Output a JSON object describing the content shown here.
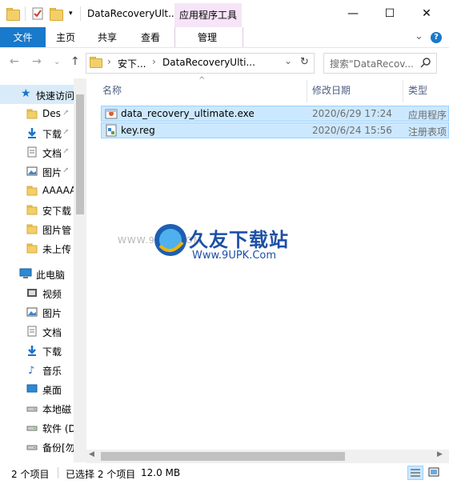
{
  "window": {
    "title": "DataRecoveryUlt...",
    "context_tab_header": "应用程序工具",
    "minimize": "—",
    "maximize": "☐",
    "close": "✕"
  },
  "ribbon": {
    "file": "文件",
    "home": "主页",
    "share": "共享",
    "view": "查看",
    "manage": "管理",
    "expand": "⌄",
    "help": "?"
  },
  "address": {
    "crumb1": "安下...",
    "crumb2": "DataRecoveryUlti...",
    "sep": "›",
    "search_placeholder": "搜索\"DataRecov...",
    "refresh": "↻",
    "dropdown": "⌄"
  },
  "nav": {
    "quick_access": "快速访问",
    "items": [
      {
        "label": "Des",
        "pinned": true,
        "icon": "folder"
      },
      {
        "label": "下载",
        "pinned": true,
        "icon": "download"
      },
      {
        "label": "文档",
        "pinned": true,
        "icon": "document"
      },
      {
        "label": "图片",
        "pinned": true,
        "icon": "picture"
      },
      {
        "label": "AAAAA",
        "pinned": false,
        "icon": "folder"
      },
      {
        "label": "安下载",
        "pinned": false,
        "icon": "folder"
      },
      {
        "label": "图片管",
        "pinned": false,
        "icon": "folder"
      },
      {
        "label": "未上传",
        "pinned": false,
        "icon": "folder"
      }
    ],
    "this_pc": "此电脑",
    "pc_items": [
      {
        "label": "视频",
        "icon": "video"
      },
      {
        "label": "图片",
        "icon": "picture"
      },
      {
        "label": "文档",
        "icon": "document"
      },
      {
        "label": "下载",
        "icon": "download"
      },
      {
        "label": "音乐",
        "icon": "music"
      },
      {
        "label": "桌面",
        "icon": "desktop"
      },
      {
        "label": "本地磁",
        "icon": "drive"
      },
      {
        "label": "软件 (D",
        "icon": "drive"
      },
      {
        "label": "备份[勿",
        "icon": "drive"
      }
    ]
  },
  "columns": {
    "name": "名称",
    "date": "修改日期",
    "type": "类型"
  },
  "files": [
    {
      "name": "data_recovery_ultimate.exe",
      "date": "2020/6/29 17:24",
      "type": "应用程序"
    },
    {
      "name": "key.reg",
      "date": "2020/6/24 15:56",
      "type": "注册表项"
    }
  ],
  "watermark": {
    "brand": "久友下载站",
    "url": "Www.9UPK.Com",
    "small": "WWW.9UPK.COM"
  },
  "status": {
    "count": "2 个项目",
    "selected": "已选择 2 个项目",
    "size": "12.0 MB"
  }
}
